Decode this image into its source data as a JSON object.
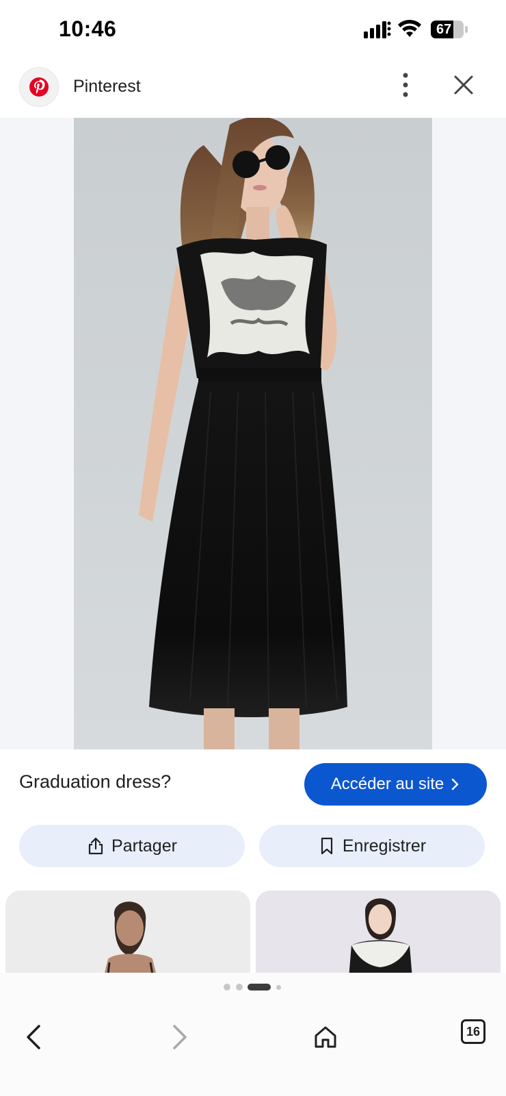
{
  "status_bar": {
    "time": "10:46",
    "battery": "67",
    "icons": [
      "signal-icon",
      "wifi-icon",
      "battery-icon"
    ]
  },
  "source": {
    "name": "Pinterest",
    "logo_icon": "pinterest-logo",
    "menu_icon": "more-vertical-icon",
    "close_icon": "close-icon",
    "brand_color": "#e60023"
  },
  "image": {
    "subject": "photo-model-black-dress"
  },
  "pin": {
    "title": "Graduation dress?",
    "visit_label": "Accéder au site",
    "accent_color": "#0b57d0"
  },
  "actions": {
    "share_label": "Partager",
    "save_label": "Enregistrer"
  },
  "pager": {
    "count": 4,
    "active_index": 2
  },
  "nav": {
    "back_icon": "back-arrow-icon",
    "forward_icon": "forward-arrow-icon",
    "home_icon": "home-icon",
    "tab_count": "16"
  }
}
